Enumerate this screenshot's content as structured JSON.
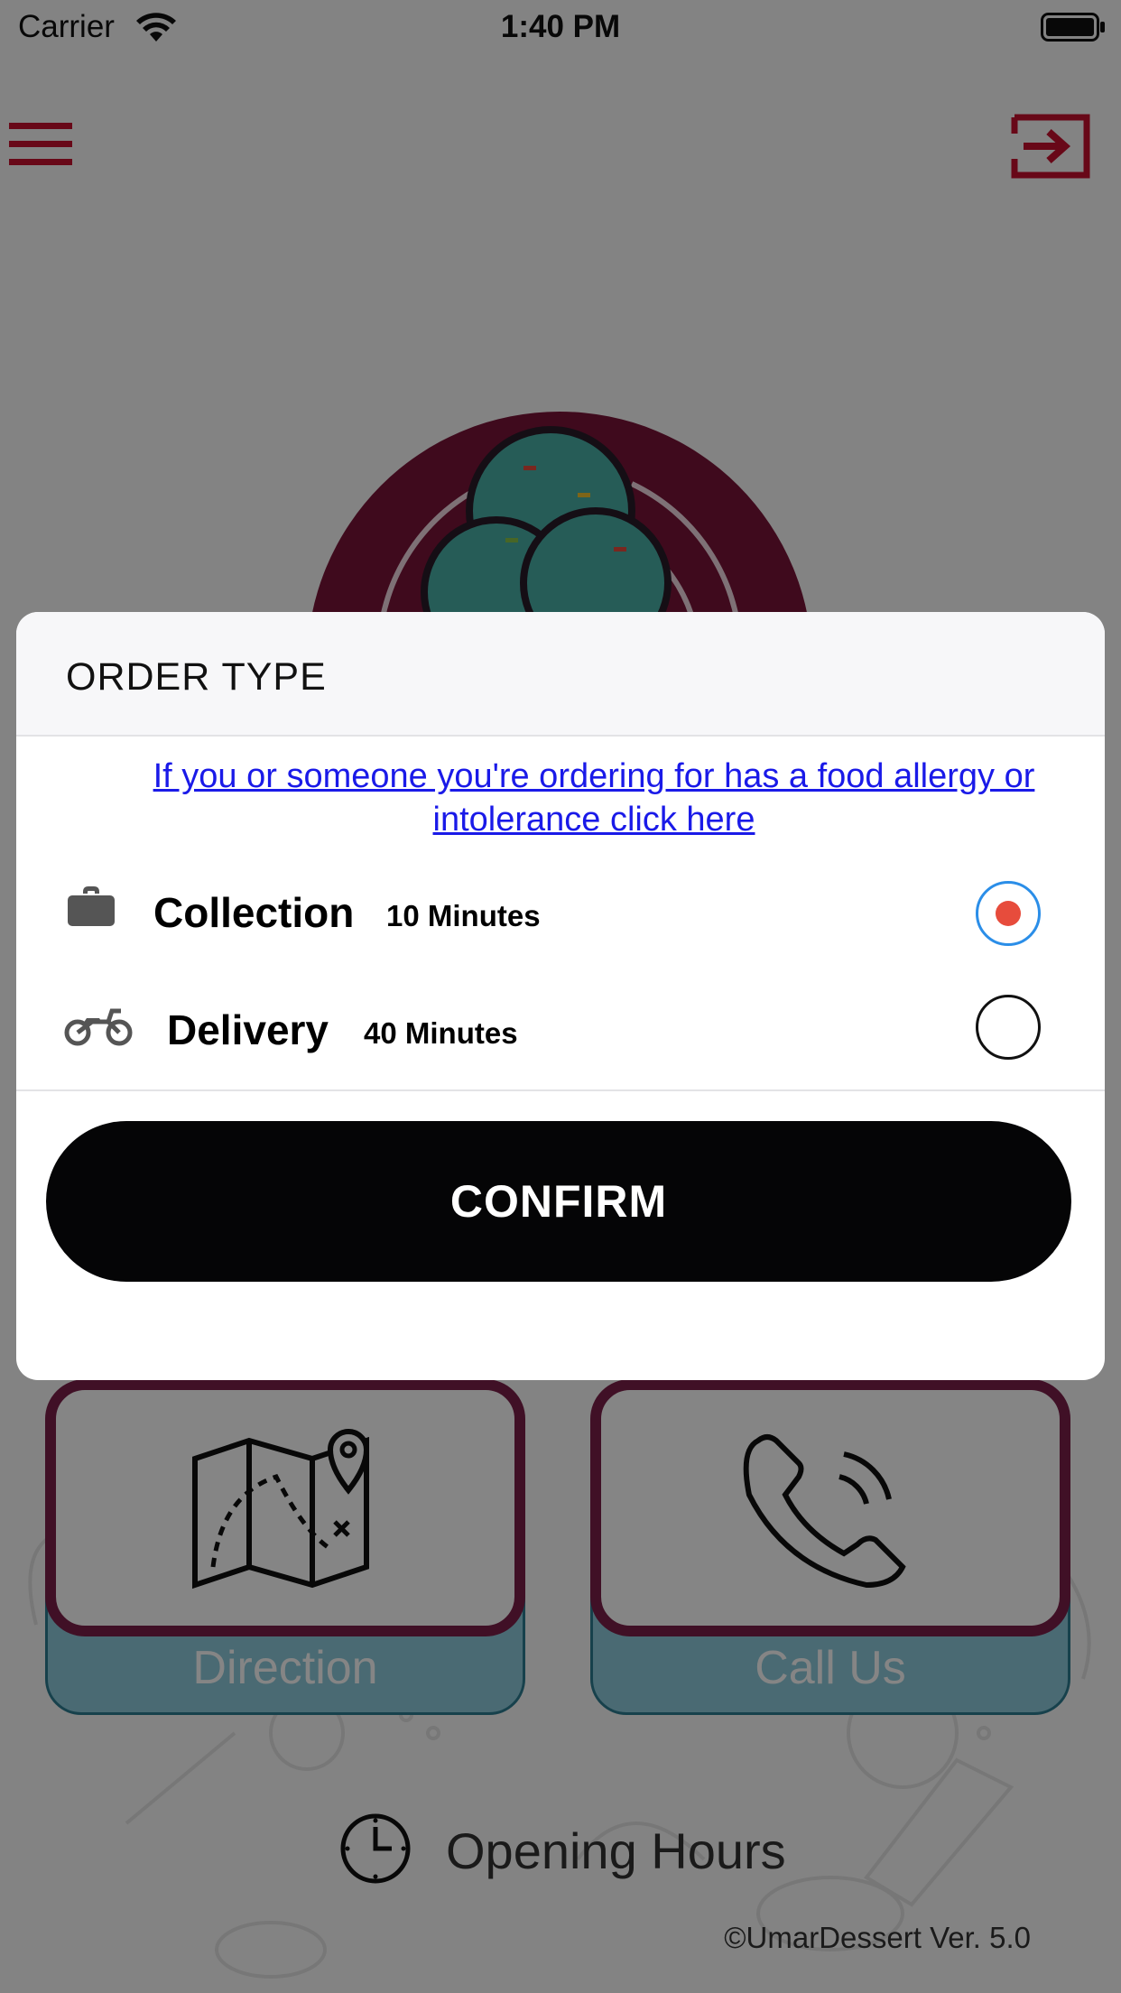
{
  "status_bar": {
    "carrier": "Carrier",
    "time": "1:40 PM"
  },
  "nav": {
    "menu_icon": "hamburger-menu-icon",
    "logout_icon": "logout-icon"
  },
  "colors": {
    "accent_red": "#c8102e",
    "tile_frame": "#7c2049",
    "tile_bg": "#8ecbdc",
    "confirm_bg": "#050506",
    "radio_selected_ring": "#2b8ee8",
    "radio_selected_dot": "#e74c3c",
    "link": "#1a1ae8"
  },
  "home": {
    "tiles": [
      {
        "label": "Direction",
        "icon": "map-icon"
      },
      {
        "label": "Call Us",
        "icon": "phone-icon"
      }
    ],
    "opening_hours_label": "Opening Hours",
    "copyright": "©UmarDessert Ver. 5.0"
  },
  "modal": {
    "title": "ORDER TYPE",
    "allergy_link": "If you or someone you're ordering for has a food allergy or intolerance click here",
    "options": [
      {
        "name": "Collection",
        "time": "10 Minutes",
        "icon": "briefcase-icon",
        "selected": true
      },
      {
        "name": "Delivery",
        "time": "40 Minutes",
        "icon": "motorbike-icon",
        "selected": false
      }
    ],
    "confirm_label": "CONFIRM"
  }
}
